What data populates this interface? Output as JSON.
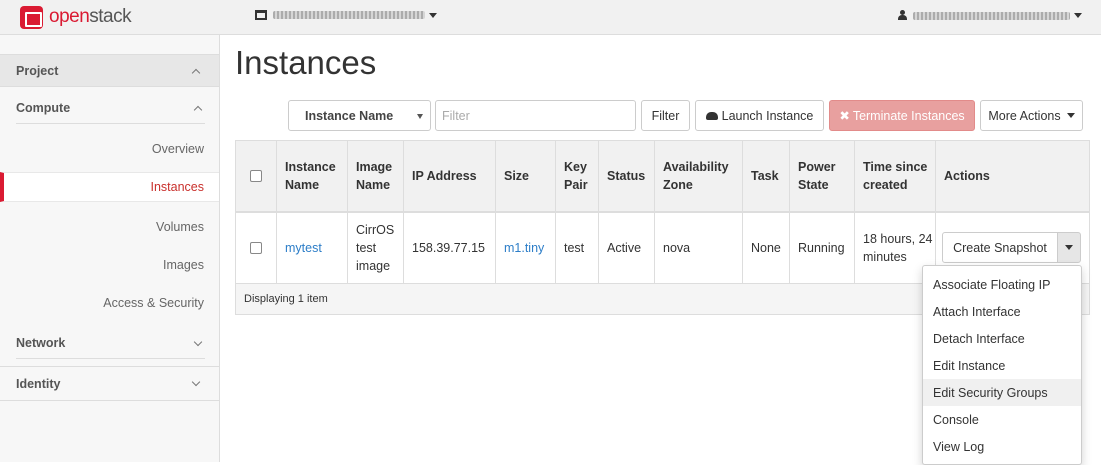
{
  "navbar": {
    "brand_prefix": "open",
    "brand_suffix": "stack",
    "project_selector": "",
    "user_menu": ""
  },
  "sidebar": {
    "project": "Project",
    "compute": "Compute",
    "items": [
      {
        "label": "Overview"
      },
      {
        "label": "Instances"
      },
      {
        "label": "Volumes"
      },
      {
        "label": "Images"
      },
      {
        "label": "Access & Security"
      }
    ],
    "network": "Network",
    "identity": "Identity"
  },
  "main": {
    "title": "Instances",
    "filter_field": "Instance Name",
    "filter_placeholder": "Filter",
    "filter_button": "Filter",
    "launch_button": "Launch Instance",
    "terminate_button": "Terminate Instances",
    "more_actions_button": "More Actions"
  },
  "table": {
    "headers": [
      "Instance Name",
      "Image Name",
      "IP Address",
      "Size",
      "Key Pair",
      "Status",
      "Availability Zone",
      "Task",
      "Power State",
      "Time since created",
      "Actions"
    ],
    "rows": [
      {
        "instance_name": "mytest",
        "image_name": "CirrOS test image",
        "ip_address": "158.39.77.15",
        "size": "m1.tiny",
        "key_pair": "test",
        "status": "Active",
        "availability_zone": "nova",
        "task": "None",
        "power_state": "Running",
        "time_since_created": "18 hours, 24 minutes",
        "action_button": "Create Snapshot"
      }
    ],
    "footer": "Displaying 1 item"
  },
  "action_menu": {
    "items": [
      "Associate Floating IP",
      "Attach Interface",
      "Detach Interface",
      "Edit Instance",
      "Edit Security Groups",
      "Console",
      "View Log"
    ],
    "highlighted": "Edit Security Groups"
  },
  "colors": {
    "accent": "#da1a32",
    "link": "#2d7ec8",
    "danger_button": "#e8a09f"
  }
}
